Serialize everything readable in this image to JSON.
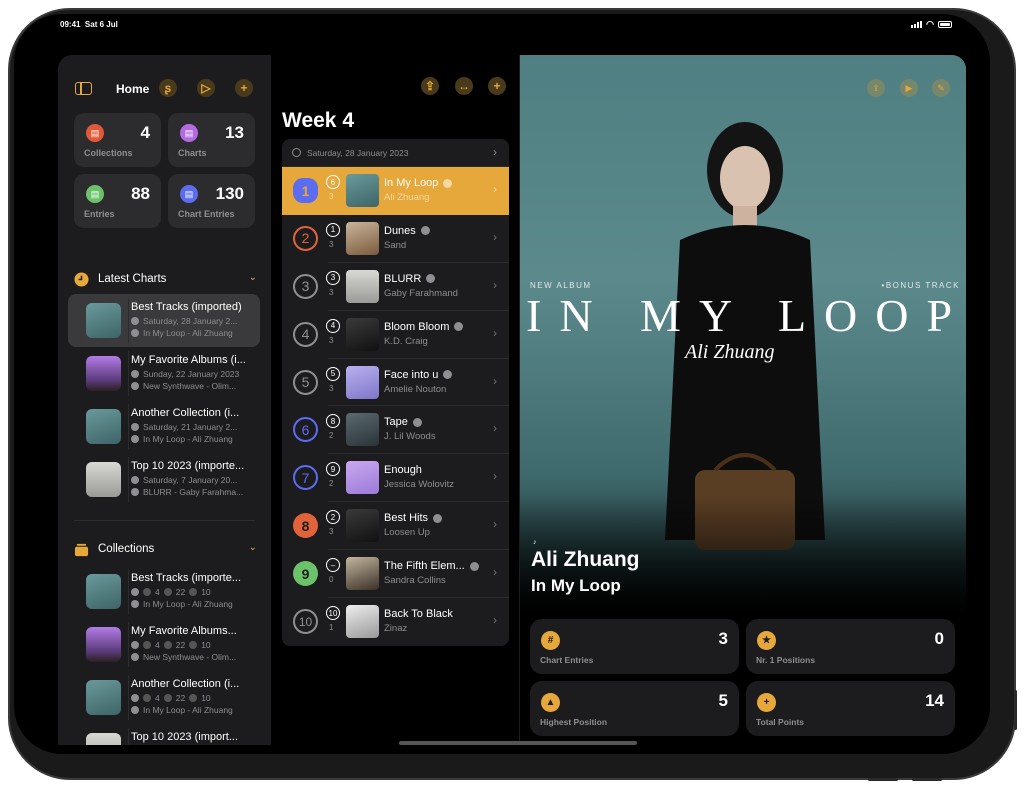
{
  "status_bar": {
    "time": "09:41",
    "date": "Sat 6 Jul"
  },
  "sidebar": {
    "title": "Home",
    "stats": [
      {
        "label": "Collections",
        "value": "4",
        "icon": "collections-icon",
        "color": "#e05a3a"
      },
      {
        "label": "Charts",
        "value": "13",
        "icon": "charts-icon",
        "color": "#b36ae2"
      },
      {
        "label": "Entries",
        "value": "88",
        "icon": "entries-icon",
        "color": "#6cc26a"
      },
      {
        "label": "Chart Entries",
        "value": "130",
        "icon": "chart-entries-icon",
        "color": "#5b6cf0"
      }
    ],
    "latest_charts": {
      "title": "Latest Charts",
      "items": [
        {
          "title": "Best Tracks (imported)",
          "date": "Saturday, 28 January 2...",
          "top": "In My Loop - Ali Zhuang",
          "art": "teal"
        },
        {
          "title": "My Favorite Albums (i...",
          "date": "Sunday, 22 January 2023",
          "top": "New Synthwave - Olim...",
          "art": "purple"
        },
        {
          "title": "Another Collection (i...",
          "date": "Saturday, 21 January 2...",
          "top": "In My Loop - Ali Zhuang",
          "art": "teal"
        },
        {
          "title": "Top 10 2023 (importe...",
          "date": "Saturday, 7 January 20...",
          "top": "BLURR - Gaby Farahma...",
          "art": "grey"
        }
      ]
    },
    "collections": {
      "title": "Collections",
      "items": [
        {
          "title": "Best Tracks (importe...",
          "c1": "4",
          "c2": "22",
          "c3": "10",
          "top": "In My Loop - Ali Zhuang",
          "art": "teal"
        },
        {
          "title": "My Favorite Albums...",
          "c1": "4",
          "c2": "22",
          "c3": "10",
          "top": "New Synthwave - Olim...",
          "art": "purple"
        },
        {
          "title": "Another Collection (i...",
          "c1": "4",
          "c2": "22",
          "c3": "10",
          "top": "In My Loop - Ali Zhuang",
          "art": "teal"
        },
        {
          "title": "Top 10 2023 (import...",
          "c1": "",
          "c2": "",
          "c3": "",
          "top": "",
          "art": "grey"
        }
      ]
    }
  },
  "chart": {
    "week_title": "Week 4",
    "date": "Saturday, 28 January 2023",
    "rows": [
      {
        "rank": "1",
        "prev": "6",
        "weeks": "3",
        "title": "In My Loop",
        "artist": "Ali Zhuang",
        "verified": true,
        "art": "teal",
        "style": "badge"
      },
      {
        "rank": "2",
        "prev": "1",
        "weeks": "3",
        "title": "Dunes",
        "artist": "Sand",
        "verified": true,
        "art": "beige",
        "style": "orange-ring"
      },
      {
        "rank": "3",
        "prev": "3",
        "weeks": "3",
        "title": "BLURR",
        "artist": "Gaby Farahmand",
        "verified": true,
        "art": "grey",
        "style": "grey-ring"
      },
      {
        "rank": "4",
        "prev": "4",
        "weeks": "3",
        "title": "Bloom Bloom",
        "artist": "K.D. Craig",
        "verified": true,
        "art": "dark",
        "style": "grey-ring"
      },
      {
        "rank": "5",
        "prev": "5",
        "weeks": "3",
        "title": "Face into u",
        "artist": "Amelie Nouton",
        "verified": true,
        "art": "lavender",
        "style": "grey-ring"
      },
      {
        "rank": "6",
        "prev": "8",
        "weeks": "2",
        "title": "Tape",
        "artist": "J. Lil Woods",
        "verified": true,
        "art": "slate",
        "style": "blue-ring"
      },
      {
        "rank": "7",
        "prev": "9",
        "weeks": "2",
        "title": "Enough",
        "artist": "Jessica Wolovitz",
        "verified": false,
        "art": "lilac",
        "style": "blue-ring"
      },
      {
        "rank": "8",
        "prev": "2",
        "weeks": "3",
        "title": "Best Hits",
        "artist": "Loosen Up",
        "verified": true,
        "art": "dark",
        "style": "orange-fill"
      },
      {
        "rank": "9",
        "prev": "–",
        "weeks": "0",
        "title": "The Fifth Elem...",
        "artist": "Sandra Collins",
        "verified": true,
        "art": "tan",
        "style": "green-fill"
      },
      {
        "rank": "10",
        "prev": "10",
        "weeks": "1",
        "title": "Back To Black",
        "artist": "Zinaz",
        "verified": false,
        "art": "white",
        "style": "grey-ring"
      }
    ]
  },
  "detail": {
    "cover": {
      "new_album": "NEW ALBUM",
      "bonus": "•BONUS TRACK",
      "big_title": "IN MY LOOP",
      "signature": "Ali Zhuang"
    },
    "artist": "Ali Zhuang",
    "song": "In My Loop",
    "stats": [
      {
        "label": "Chart Entries",
        "value": "3",
        "glyph": "#",
        "icon": "hash-icon"
      },
      {
        "label": "Nr. 1 Positions",
        "value": "0",
        "glyph": "★",
        "icon": "star-icon"
      },
      {
        "label": "Highest Position",
        "value": "5",
        "glyph": "▲",
        "icon": "triangle-up-icon"
      },
      {
        "label": "Total Points",
        "value": "14",
        "glyph": "+",
        "icon": "plus-icon"
      }
    ]
  },
  "colors": {
    "accent": "#e6a73b",
    "highlight_row": "#e6a73b",
    "blue": "#5b6cf0",
    "orange": "#e2633a",
    "green": "#6cc26a"
  }
}
